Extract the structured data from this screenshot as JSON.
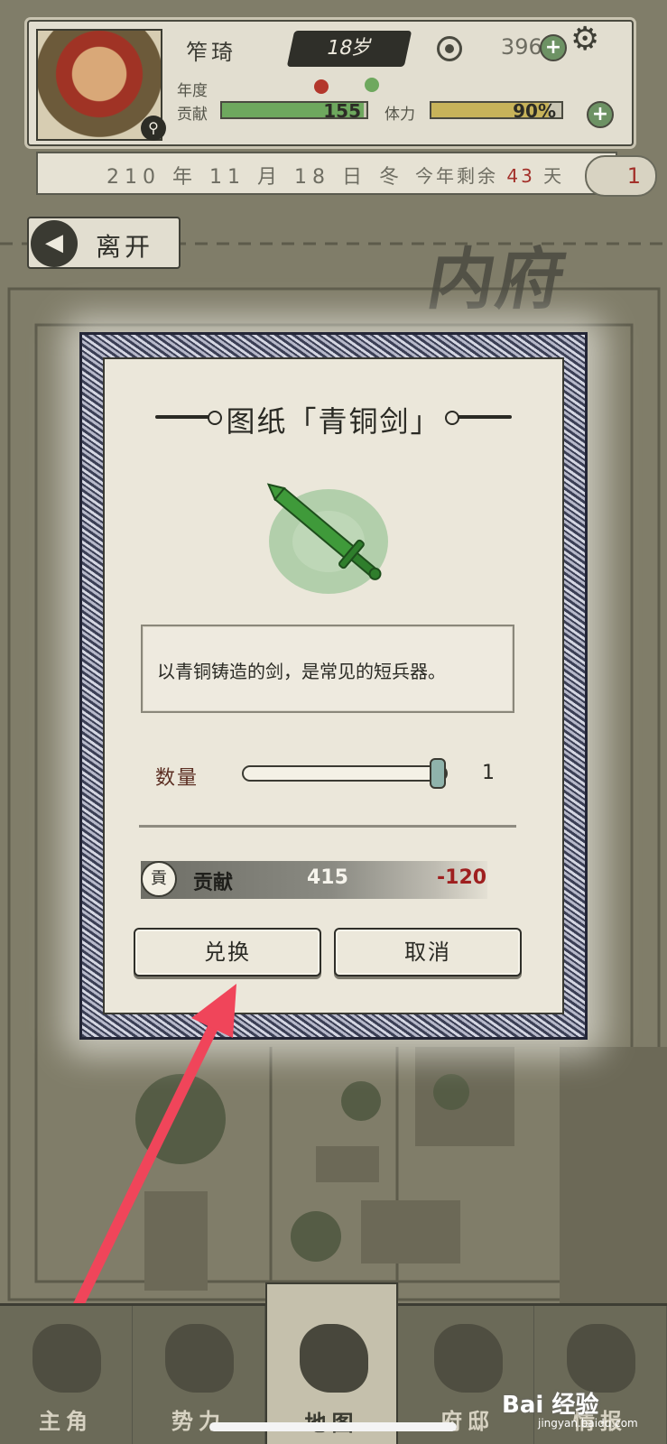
{
  "hud": {
    "name": "笮琦",
    "age": "18岁",
    "coins": "3965",
    "year_label": "年度",
    "contribution_label": "贡献",
    "contribution_value": "155",
    "contribution_fraction": 0.98,
    "stamina_label": "体力",
    "stamina_value": "90%",
    "stamina_fraction": 0.9,
    "date": "210 年 11 月 18 日 冬",
    "remaining_prefix": "今年剩余",
    "remaining_days": "43",
    "remaining_suffix": "天",
    "badge_count": "1"
  },
  "leave_button": {
    "label": "离开"
  },
  "location_title": "内府",
  "dialog": {
    "title": "图纸「青铜剑」",
    "item_icon": "bronze-sword-icon",
    "description": "以青铜铸造的剑，是常见的短兵器。",
    "quantity_label": "数量",
    "quantity_value": "1",
    "quantity_slider_fraction": 1.0,
    "cost_icon_glyph": "貢",
    "cost_label": "贡献",
    "cost_balance": "415",
    "cost_delta": "-120",
    "confirm_label": "兑换",
    "cancel_label": "取消"
  },
  "nav": {
    "items": [
      {
        "label": "主角",
        "icon": "character-icon"
      },
      {
        "label": "势力",
        "icon": "flag-icon"
      },
      {
        "label": "地图",
        "icon": "map-icon",
        "active": true
      },
      {
        "label": "府邸",
        "icon": "mansion-icon"
      },
      {
        "label": "情报",
        "icon": "intel-icon"
      }
    ]
  },
  "watermark": {
    "text": "Bai 经验",
    "sub": "jingyan.baidu.com"
  },
  "colors": {
    "accent_red": "#a3302a",
    "contribution_green": "#6ea85e",
    "stamina_yellow": "#c7b35a",
    "slider_thumb": "#8fb3ab",
    "cost_negative": "#9e1f1f",
    "pointer_arrow": "#f0455a"
  }
}
